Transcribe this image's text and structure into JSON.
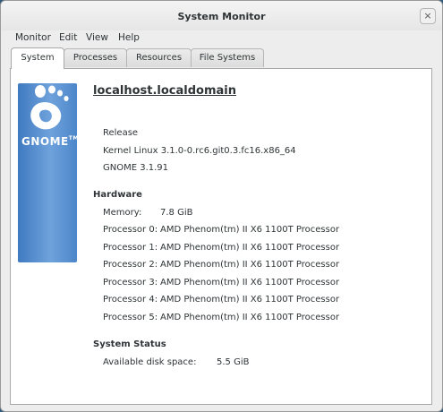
{
  "window": {
    "title": "System Monitor",
    "close_glyph": "×"
  },
  "menubar": [
    "Monitor",
    "Edit",
    "View",
    "Help"
  ],
  "tabs": [
    {
      "label": "System",
      "active": true
    },
    {
      "label": "Processes",
      "active": false
    },
    {
      "label": "Resources",
      "active": false
    },
    {
      "label": "File Systems",
      "active": false
    }
  ],
  "logo": {
    "text": "GNOME",
    "tm": "TM",
    "icon": "gnome-foot-icon"
  },
  "system": {
    "hostname": "localhost.localdomain",
    "release": "Release",
    "kernel": "Kernel Linux 3.1.0-0.rc6.git0.3.fc16.x86_64",
    "gnome": "GNOME 3.1.91"
  },
  "hardware": {
    "heading": "Hardware",
    "memory_label": "Memory:",
    "memory_value": "7.8 GiB",
    "processors": [
      {
        "label": "Processor 0:",
        "value": "AMD Phenom(tm) II X6 1100T Processor"
      },
      {
        "label": "Processor 1:",
        "value": "AMD Phenom(tm) II X6 1100T Processor"
      },
      {
        "label": "Processor 2:",
        "value": "AMD Phenom(tm) II X6 1100T Processor"
      },
      {
        "label": "Processor 3:",
        "value": "AMD Phenom(tm) II X6 1100T Processor"
      },
      {
        "label": "Processor 4:",
        "value": "AMD Phenom(tm) II X6 1100T Processor"
      },
      {
        "label": "Processor 5:",
        "value": "AMD Phenom(tm) II X6 1100T Processor"
      }
    ]
  },
  "status": {
    "heading": "System Status",
    "disk_label": "Available disk space:",
    "disk_value": "5.5 GiB"
  },
  "colors": {
    "background": "#2f5a7c",
    "logo_blue": "#4c86c9",
    "panel": "#ffffff"
  }
}
